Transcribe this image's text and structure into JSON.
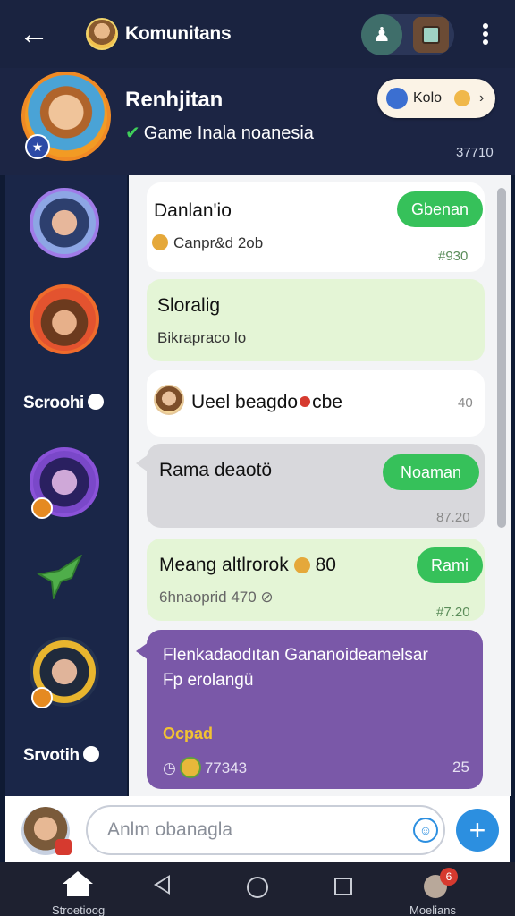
{
  "header": {
    "back_icon": "arrow-left-icon",
    "title": "Komunitans",
    "actions": [
      "person-icon",
      "calendar-icon",
      "more-vert-icon"
    ]
  },
  "profile": {
    "name": "Renhjitan",
    "subtitle": "Game Inala noanesia",
    "check": "✔",
    "follow_label": "Kolo",
    "count": "37710"
  },
  "sidebar": {
    "labels": [
      "Scroohi",
      "Srvotih"
    ]
  },
  "messages": [
    {
      "title": "Danlan'io",
      "subtitle": "Canpr&d 2ob",
      "button": "Gbenan",
      "time": "#930"
    },
    {
      "title": "Sloralig",
      "subtitle": "Bikrapraco lo"
    },
    {
      "title": "Ueel beagdo",
      "after": "cbe",
      "time": "40"
    },
    {
      "title": "Rama deaotö",
      "button": "Noaman",
      "time": "87.20"
    },
    {
      "title": "Meang altlrorok",
      "after": "80",
      "subtitle": "6hnaoprid 470 ⊘",
      "button": "Rami",
      "time": "#7.20"
    },
    {
      "title": "Flenkadaodıtan Gananoideamelsar",
      "line2": "Fp erolangü",
      "highlight": "Ocpad",
      "meta": "77343",
      "time": "25"
    }
  ],
  "composer": {
    "placeholder": "Anlm obanagla"
  },
  "nav": {
    "left_label": "Stroetioog",
    "right_label": "Moelians",
    "notif_count": "6"
  },
  "colors": {
    "accent_green": "#36c15a",
    "accent_blue": "#2c8fe0",
    "purple_card": "#7a58a8",
    "header_bg": "#1a2340"
  }
}
